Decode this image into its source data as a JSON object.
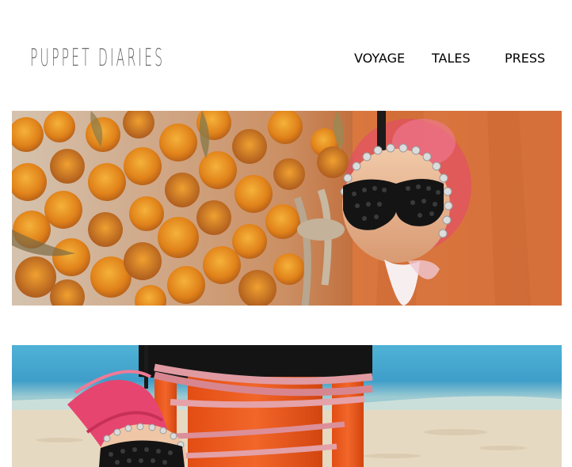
{
  "site": {
    "title": "PUPPET DIARIES"
  },
  "nav": {
    "items": [
      {
        "label": "VOYAGE"
      },
      {
        "label": "TALES"
      },
      {
        "label": "PRESS"
      }
    ]
  },
  "colors": {
    "title": "#6b6b6b",
    "nav": "#2b2b2b",
    "background": "#ffffff",
    "marigold": "#e48a1a",
    "orange_backdrop": "#d9773f",
    "sea": "#3f9ec9",
    "sand": "#e8dcc6",
    "pink_feathers": "#e6456f"
  }
}
